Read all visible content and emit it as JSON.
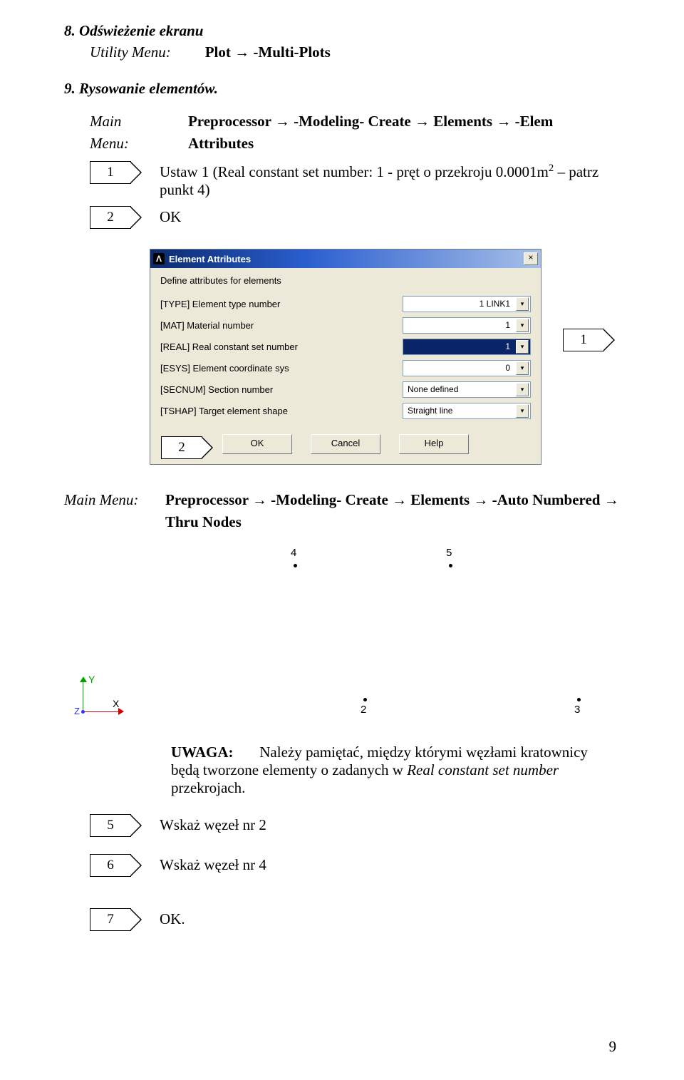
{
  "section8": {
    "heading": "8. Odświeżenie ekranu",
    "menu_label": "Utility Menu:",
    "menu_path": "Plot → -Multi-Plots"
  },
  "section9": {
    "heading": "9. Rysowanie elementów.",
    "menu_label": "Main Menu:",
    "menu_path": "Preprocessor → -Modeling- Create → Elements → -Elem Attributes",
    "step1_num": "1",
    "step1_a": "Ustaw 1 (Real constant set number: 1  - pręt o przekroju 0.0001m",
    "step1_sup": "2",
    "step1_b": " – patrz punkt 4)",
    "step2_num": "2",
    "step2_text": "OK"
  },
  "dialog": {
    "title": "Element Attributes",
    "header": "Define attributes for elements",
    "rows": {
      "type_label": "[TYPE]   Element type number",
      "type_value": "1   LINK1",
      "mat_label": "[MAT]   Material number",
      "mat_value": "1",
      "real_label": "[REAL]   Real constant set number",
      "real_value": "1",
      "esys_label": "[ESYS]   Element coordinate sys",
      "esys_value": "0",
      "sec_label": "[SECNUM]   Section number",
      "sec_value": "None defined",
      "tshap_label": "[TSHAP]   Target element shape",
      "tshap_value": "Straight line"
    },
    "ok": "OK",
    "cancel": "Cancel",
    "help": "Help",
    "callout1": "1",
    "callout2": "2"
  },
  "thru_nodes": {
    "menu_label": "Main Menu:",
    "menu_path_a": "Preprocessor → -Modeling- Create → Elements → -Auto Numbered → ",
    "menu_path_b": "Thru Nodes",
    "node4": "4",
    "node5": "5",
    "node2": "2",
    "node3": "3",
    "axis_y": "Y",
    "axis_x": "X",
    "axis_z": "Z"
  },
  "note": {
    "label": "UWAGA:",
    "text_a": "Należy pamiętać, między którymi węzłami kratownicy ",
    "text_b": "będą tworzone elementy o zadanych w ",
    "text_c": "Real constant set number",
    "text_d": " przekrojach."
  },
  "steps_bottom": {
    "s5_num": "5",
    "s5_text": "Wskaż węzeł nr 2",
    "s6_num": "6",
    "s6_text": "Wskaż węzeł nr 4",
    "s7_num": "7",
    "s7_text": "OK."
  },
  "page_number": "9"
}
